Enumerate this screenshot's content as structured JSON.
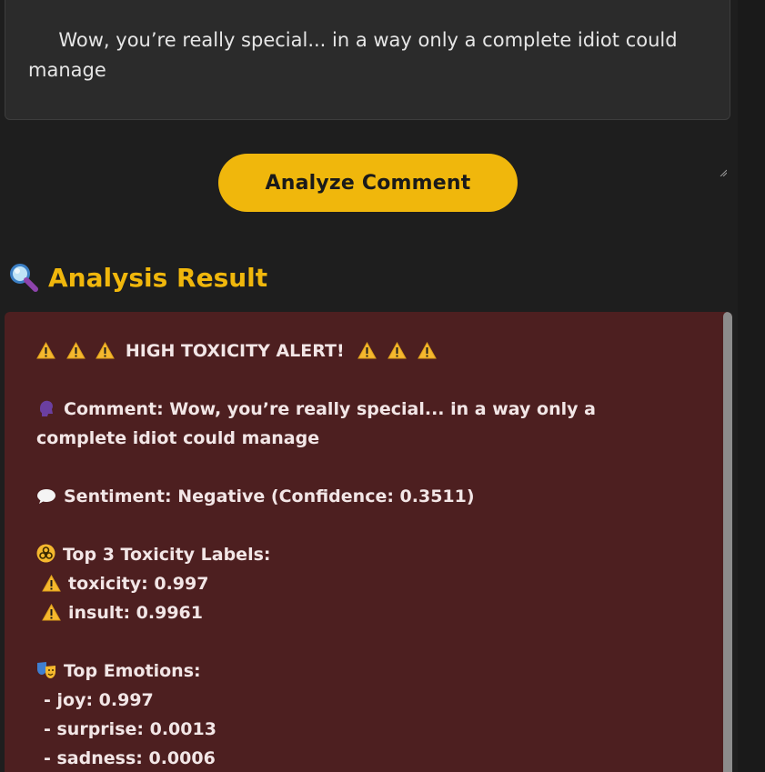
{
  "comment_input": {
    "value": " Wow, you’re really special... in a way only a complete idiot could manage"
  },
  "analyze_button": {
    "label": "Analyze Comment"
  },
  "result_section": {
    "icon": "magnifying-glass-icon",
    "title": "Analysis Result"
  },
  "result": {
    "alert_text": "HIGH TOXICITY ALERT!",
    "alert_icon": "warning-icon",
    "comment_line": "Comment: Wow, you’re really special... in a way only a complete idiot could manage",
    "sentiment_line": "Sentiment: Negative (Confidence: 0.3511)",
    "toxicity_header": "Top 3 Toxicity Labels:",
    "toxicity_labels": [
      "toxicity: 0.997",
      "insult: 0.9961"
    ],
    "emotions_header": "Top Emotions:",
    "emotions": [
      "- joy: 0.997",
      "- surprise: 0.0013",
      "- sadness: 0.0006"
    ]
  },
  "colors": {
    "background": "#1e1e1e",
    "accent": "#f0b70c",
    "result_panel": "#4d1f20",
    "result_text": "#f2e6e6"
  }
}
